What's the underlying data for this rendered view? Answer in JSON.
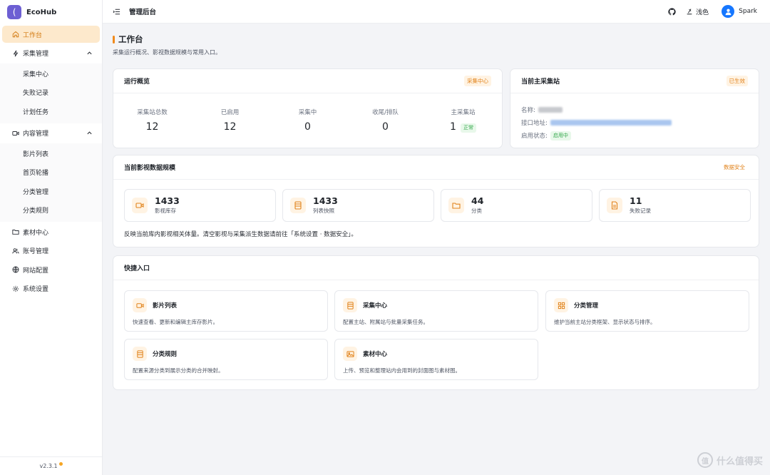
{
  "brand": {
    "logo_char": "(",
    "name": "EcoHub"
  },
  "sidebar": {
    "items": [
      {
        "label": "工作台",
        "icon": "home-icon"
      },
      {
        "label": "采集管理",
        "icon": "bolt-icon",
        "children": [
          "采集中心",
          "失败记录",
          "计划任务"
        ]
      },
      {
        "label": "内容管理",
        "icon": "video-icon",
        "children": [
          "影片列表",
          "首页轮播",
          "分类管理",
          "分类规则"
        ]
      },
      {
        "label": "素材中心",
        "icon": "folder-icon"
      },
      {
        "label": "账号管理",
        "icon": "users-icon"
      },
      {
        "label": "网站配置",
        "icon": "globe-icon"
      },
      {
        "label": "系统设置",
        "icon": "gear-icon"
      }
    ],
    "version": "v2.3.1"
  },
  "topbar": {
    "title": "管理后台",
    "theme_label": "浅色",
    "user_name": "Spark"
  },
  "page": {
    "title": "工作台",
    "subtitle": "采集运行概况、影视数据规模与常用入口。"
  },
  "overview": {
    "title": "运行概览",
    "tag": "采集中心",
    "stats": [
      {
        "label": "采集站总数",
        "value": "12"
      },
      {
        "label": "已启用",
        "value": "12"
      },
      {
        "label": "采集中",
        "value": "0"
      },
      {
        "label": "收尾/排队",
        "value": "0"
      },
      {
        "label": "主采集站",
        "value": "1",
        "badge": "正常"
      }
    ]
  },
  "main_station": {
    "title": "当前主采集站",
    "tag": "已生效",
    "name_label": "名称:",
    "api_label": "接口地址:",
    "status_label": "启用状态:",
    "status_value": "启用中"
  },
  "data_scale": {
    "title": "当前影视数据规模",
    "tag": "数据安全",
    "metrics": [
      {
        "value": "1433",
        "label": "影视库存",
        "icon": "video-icon"
      },
      {
        "value": "1433",
        "label": "列表快照",
        "icon": "list-icon"
      },
      {
        "value": "44",
        "label": "分类",
        "icon": "folder-icon"
      },
      {
        "value": "11",
        "label": "失败记录",
        "icon": "file-icon"
      }
    ],
    "note": "反映当前库内影视相关体量。清空影视与采集派生数据请前往「系统设置 · 数据安全」。"
  },
  "shortcuts": {
    "title": "快捷入口",
    "items": [
      {
        "title": "影片列表",
        "desc": "快速查看、更新和编辑主库存影片。",
        "icon": "video-icon"
      },
      {
        "title": "采集中心",
        "desc": "配置主站、附属站与批量采集任务。",
        "icon": "list-icon"
      },
      {
        "title": "分类管理",
        "desc": "维护当前主站分类框架、显示状态与排序。",
        "icon": "grid-icon"
      },
      {
        "title": "分类规则",
        "desc": "配置来源分类到展示分类的合并映射。",
        "icon": "list-icon"
      },
      {
        "title": "素材中心",
        "desc": "上传、预览和整理站内会用到的封面图与素材图。",
        "icon": "image-icon"
      }
    ]
  },
  "watermark": {
    "text": "什么值得买",
    "mark": "值"
  },
  "colors": {
    "accent": "#f08a1c",
    "active_bg": "#fde9cc",
    "brand": "#6d5fd3",
    "success": "#36a94d"
  }
}
